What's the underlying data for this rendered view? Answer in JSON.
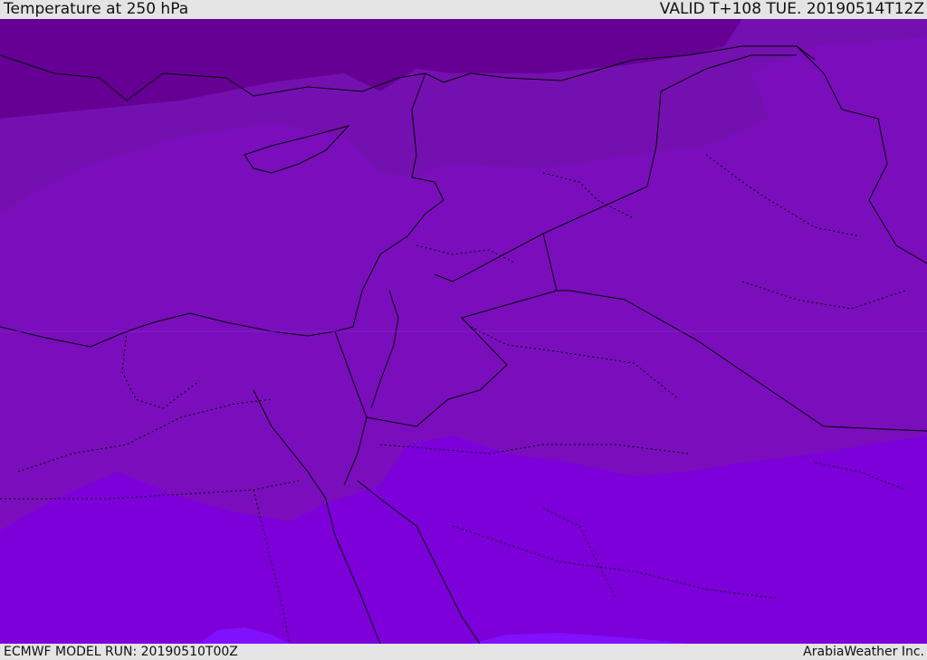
{
  "header": {
    "title": "Temperature at 250 hPa",
    "valid": "VALID T+108 TUE. 20190514T12Z"
  },
  "footer": {
    "model_run": "ECMWF MODEL RUN: 20190510T00Z",
    "credit": "ArabiaWeather Inc."
  },
  "map": {
    "field": "Temperature at 250 hPa",
    "colors": {
      "coldest": "#660095",
      "cold": "#7510b0",
      "mid": "#7a0ebc",
      "warm": "#7d00da",
      "warmest": "#8010ff",
      "border": "#000000"
    }
  }
}
